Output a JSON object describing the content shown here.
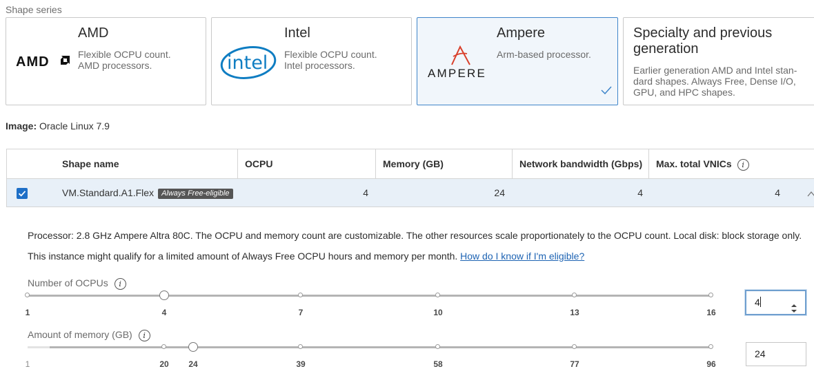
{
  "section_label": "Shape series",
  "cards": [
    {
      "title": "AMD",
      "logo_text": "AMD",
      "desc_lines": [
        "Flexible OCPU count.",
        "AMD processors."
      ],
      "selected": false
    },
    {
      "title": "Intel",
      "logo_text": "intel",
      "desc_lines": [
        "Flexible OCPU count.",
        "Intel processors."
      ],
      "selected": false
    },
    {
      "title": "Ampere",
      "logo_text": "AMPERE",
      "desc_lines": [
        "Arm-based processor."
      ],
      "selected": true
    },
    {
      "title_lines": [
        "Specialty and previous",
        "generation"
      ],
      "desc_lines": [
        "Earlier generation AMD and Intel stan-",
        "dard shapes. Always Free, Dense I/O,",
        "GPU, and HPC shapes."
      ],
      "selected": false
    }
  ],
  "image": {
    "label": "Image:",
    "value": "Oracle Linux 7.9"
  },
  "table": {
    "headers": [
      "Shape name",
      "OCPU",
      "Memory (GB)",
      "Network bandwidth (Gbps)",
      "Max. total VNICs"
    ],
    "row": {
      "name": "VM.Standard.A1.Flex",
      "badge": "Always Free-eligible",
      "ocpu": "4",
      "memory": "24",
      "bandwidth": "4",
      "vnics": "4",
      "checked": true
    }
  },
  "details": {
    "processor_text": "Processor: 2.8 GHz Ampere Altra 80C. The OCPU and memory count are customizable. The other resources scale proportionately to the OCPU count. Local disk: block storage only.",
    "free_text": "This instance might qualify for a limited amount of Always Free OCPU hours and memory per month.",
    "free_link": "How do I know if I'm eligible?"
  },
  "ocpu_slider": {
    "label": "Number of OCPUs",
    "min": 1,
    "max": 16,
    "value": 4,
    "ticks": [
      "1",
      "4",
      "7",
      "10",
      "13",
      "16"
    ],
    "input_value": "4"
  },
  "memory_slider": {
    "label": "Amount of memory (GB)",
    "min": 1,
    "max": 96,
    "value": 24,
    "ticks": [
      "1",
      "20",
      "24",
      "39",
      "58",
      "77",
      "96"
    ],
    "input_value": "24"
  },
  "colors": {
    "accent": "#3d84c9",
    "selected_bg": "#f1f6fb",
    "row_bg": "#e8f0f8",
    "checkbox": "#1e6fc7",
    "ampere_red": "#d9402b",
    "intel_blue": "#0f7dc2"
  },
  "icons": [
    "amd-logo",
    "intel-logo",
    "ampere-logo",
    "check-icon",
    "info-icon",
    "chevron-up-icon",
    "spinner-arrows-icon"
  ]
}
